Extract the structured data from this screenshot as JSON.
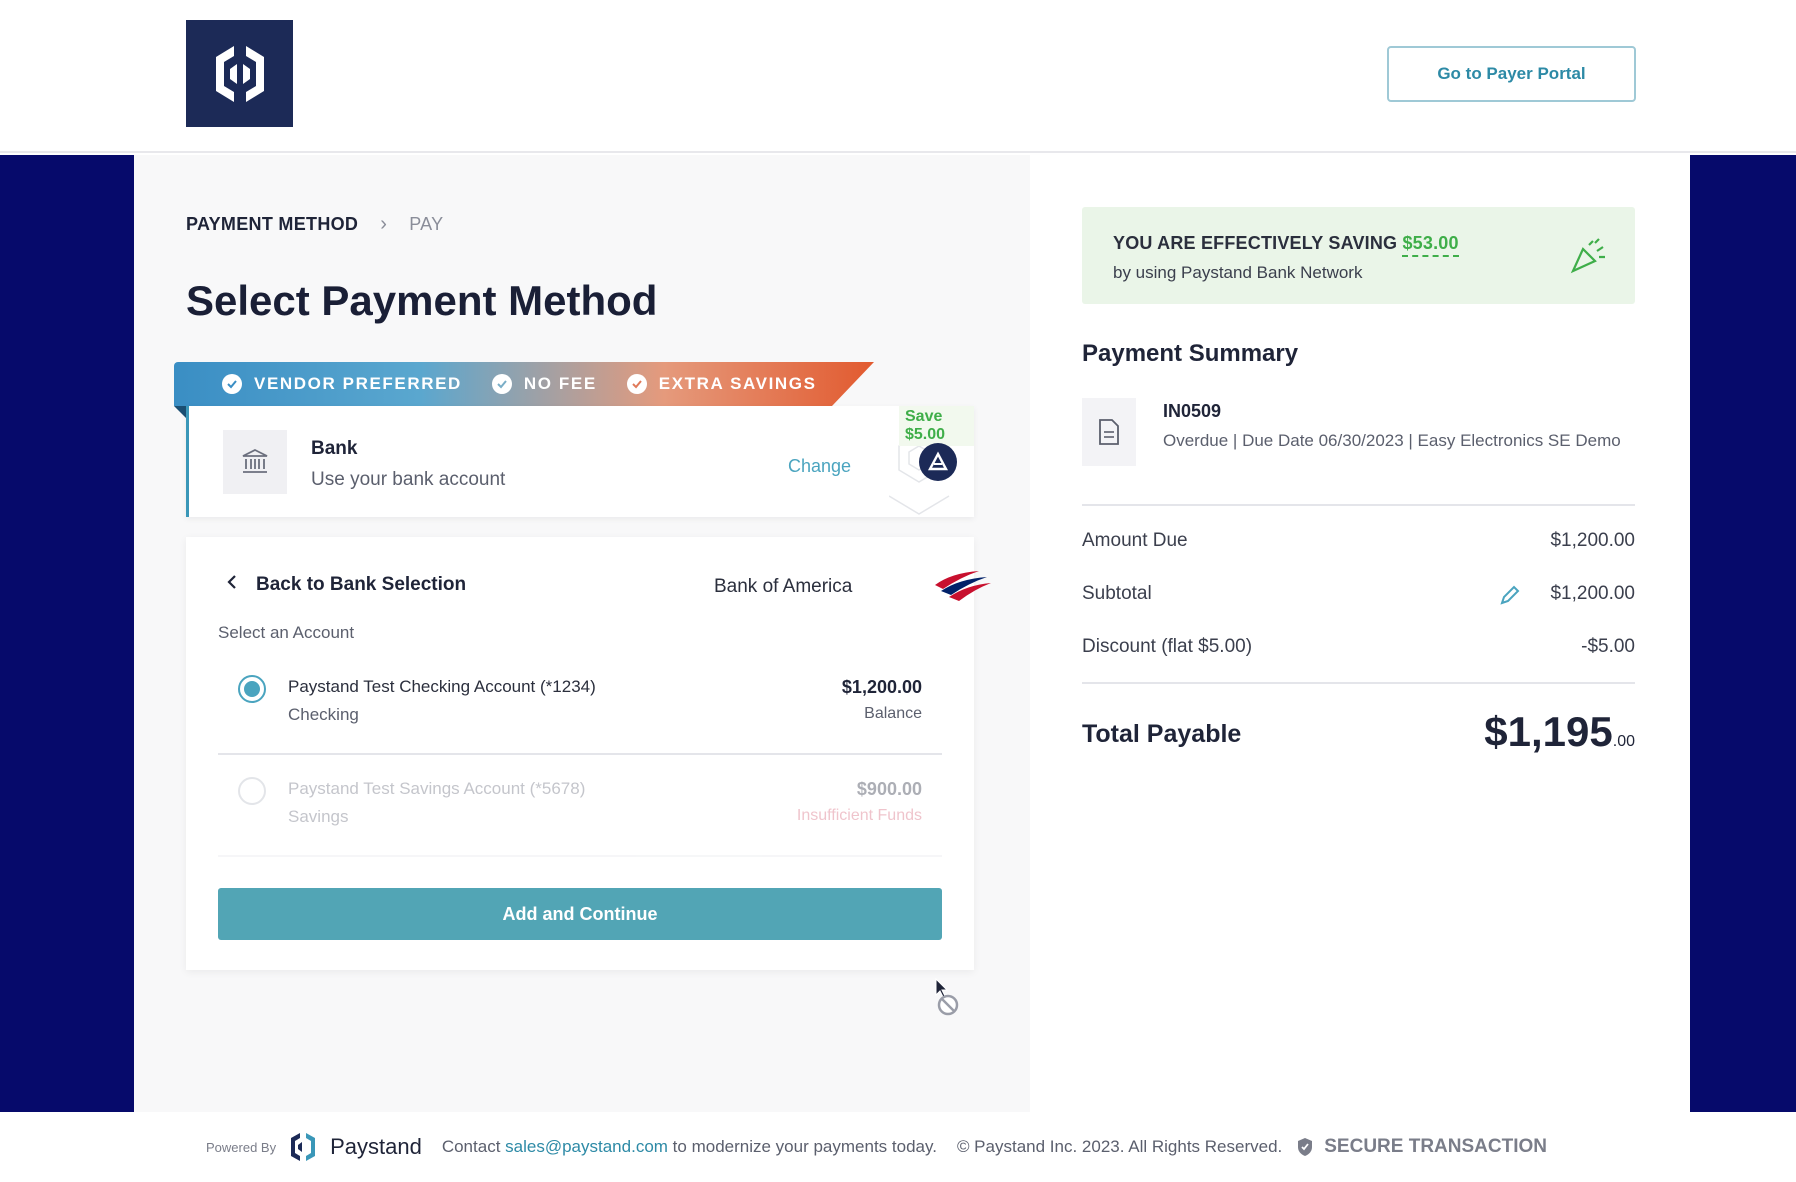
{
  "header": {
    "portal_button": "Go to Payer Portal"
  },
  "breadcrumb": {
    "active": "PAYMENT METHOD",
    "inactive": "PAY"
  },
  "page_title": "Select Payment Method",
  "ribbon": {
    "items": [
      "VENDOR PREFERRED",
      "NO FEE",
      "EXTRA SAVINGS"
    ]
  },
  "bank_card": {
    "name": "Bank",
    "subtitle": "Use your bank account",
    "change": "Change",
    "save_badge": "Save $5.00"
  },
  "accounts": {
    "back_label": "Back to Bank Selection",
    "bank_name": "Bank of America",
    "select_label": "Select an Account",
    "list": [
      {
        "name": "Paystand Test Checking Account (*1234)",
        "type": "Checking",
        "amount": "$1,200.00",
        "note": "Balance",
        "selected": true
      },
      {
        "name": "Paystand Test Savings Account (*5678)",
        "type": "Savings",
        "amount": "$900.00",
        "note": "Insufficient Funds",
        "selected": false
      }
    ],
    "add_button": "Add and Continue"
  },
  "saving": {
    "title_prefix": "YOU ARE EFFECTIVELY SAVING",
    "amount": "$53.00",
    "subtitle": "by using Paystand Bank Network"
  },
  "summary": {
    "title": "Payment Summary",
    "invoice_number": "IN0509",
    "invoice_meta": "Overdue | Due Date 06/30/2023 | Easy Electronics SE Demo",
    "rows": [
      {
        "label": "Amount Due",
        "value": "$1,200.00"
      },
      {
        "label": "Subtotal",
        "value": "$1,200.00"
      },
      {
        "label": "Discount (flat $5.00)",
        "value": "-$5.00"
      }
    ],
    "total_label": "Total Payable",
    "total_main": "$1,195",
    "total_cents": ".00"
  },
  "footer": {
    "powered_by": "Powered By",
    "brand": "Paystand",
    "contact_prefix": "Contact",
    "email": "sales@paystand.com",
    "contact_suffix": "to modernize your payments today.",
    "copyright": "© Paystand Inc. 2023. All Rights Reserved.",
    "secure": "SECURE TRANSACTION"
  },
  "colors": {
    "navy": "#060a6b",
    "teal": "#52a5b5",
    "green": "#3fae49",
    "logo_bg": "#1c2a57"
  }
}
